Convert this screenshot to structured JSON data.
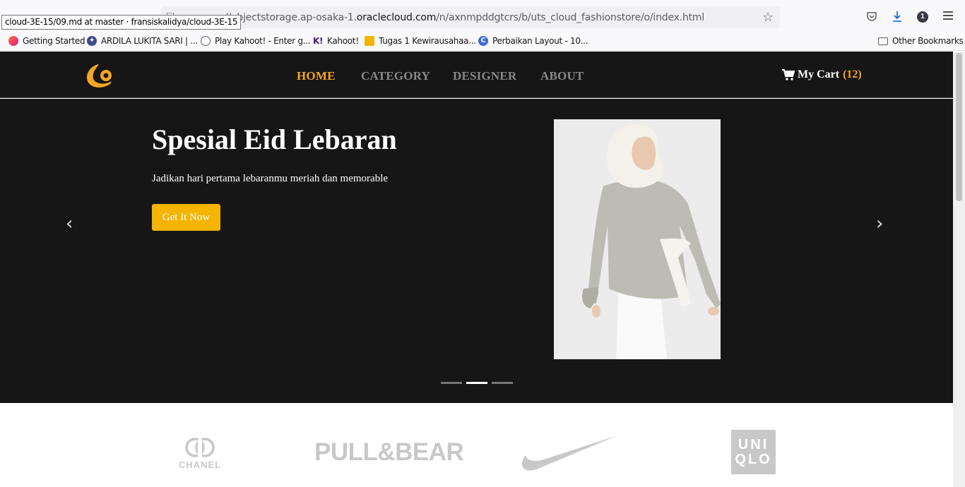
{
  "browser": {
    "url_prefix": "//objectstorage.ap-osaka-1.",
    "url_domain": "oraclecloud.com",
    "url_path": "/n/axnmpddgtcrs/b/uts_cloud_fashionstore/o/index.html",
    "tooltip": "cloud-3E-15/09.md at master · fransiskalidya/cloud-3E-15",
    "account_badge": "1",
    "bookmarks": [
      {
        "label": "Getting Started",
        "icon": "firefox-icon",
        "color": "#ff7139"
      },
      {
        "label": "ARDILA LUKITA SARI | ...",
        "icon": "university-icon",
        "color": "#3b4a8c"
      },
      {
        "label": "Play Kahoot! - Enter g...",
        "icon": "globe-icon",
        "color": "#5b5b66"
      },
      {
        "label": "Kahoot!",
        "icon": "kahoot-icon",
        "color": "#46178f"
      },
      {
        "label": "Tugas 1 Kewirausahaa...",
        "icon": "slides-icon",
        "color": "#f4b400"
      },
      {
        "label": "Perbaikan Layout - 10...",
        "icon": "canva-icon",
        "color": "#3b6be0"
      }
    ],
    "other_bookmarks": "Other Bookmarks"
  },
  "nav": {
    "items": [
      "HOME",
      "CATEGORY",
      "DESIGNER",
      "ABOUT"
    ],
    "cart_label": "My Cart",
    "cart_count": "(12)"
  },
  "hero": {
    "title": "Spesial Eid Lebaran",
    "subtitle": "Jadikan hari pertama lebaranmu meriah dan memorable",
    "button": "Get It Now",
    "slides": 3,
    "active_slide": 2
  },
  "brands": [
    "CHANEL",
    "PULL&BEAR",
    "NIKE",
    "UNIQLO"
  ],
  "colors": {
    "accent": "#f5a623",
    "button": "#f5b400",
    "dark": "#161616"
  }
}
